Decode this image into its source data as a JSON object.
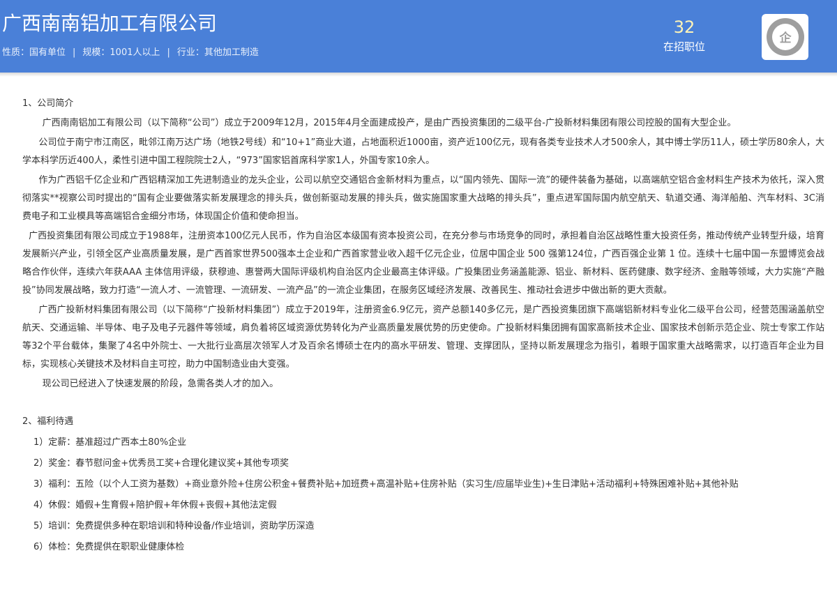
{
  "header": {
    "company_name": "广西南南铝加工有限公司",
    "nature": "性质：国有单位",
    "scale": "规模：1001人以上",
    "industry": "行业：其他加工制造",
    "separator": "|",
    "job_count": "32",
    "job_count_label": "在招职位",
    "logo_text": "企",
    "logo_icon": "company-logo-icon"
  },
  "intro": {
    "title": "1、公司简介",
    "paragraphs": [
      "广西南南铝加工有限公司（以下简称“公司”）成立于2009年12月，2015年4月全面建成投产，是由广西投资集团的二级平台-广投新材料集团有限公司控股的国有大型企业。",
      "公司位于南宁市江南区，毗邻江南万达广场（地铁2号线）和“10+1”商业大道，占地面积近1000亩，资产近100亿元，现有各类专业技术人才500余人，其中博士学历11人，硕士学历80余人，大学本科学历近400人，柔性引进中国工程院院士2人，“973”国家铝首席科学家1人，外国专家10余人。",
      "作为广西铝千亿企业和广西铝精深加工先进制造业的龙头企业，公司以航空交通铝合金新材料为重点，以“国内领先、国际一流”的硬件装备为基础，以高端航空铝合金材料生产技术为依托，深入贯彻落实**视察公司时提出的“国有企业要做落实新发展理念的排头兵，做创新驱动发展的排头兵，做实施国家重大战略的排头兵”，重点进军国际国内航空航天、轨道交通、海洋船舶、汽车材料、3C消费电子和工业模具等高端铝合金细分市场，体现国企价值和使命担当。",
      "广西投资集团有限公司成立于1988年，注册资本100亿元人民币，作为自治区本级国有资本投资公司，在充分参与市场竞争的同时，承担着自治区战略性重大投资任务，推动传统产业转型升级，培育发展新兴产业，引领全区产业高质量发展，是广西首家世界500强本土企业和广西首家营业收入超千亿元企业，位居中国企业 500 强第124位，广西百强企业第 1 位。连续十七届中国一东盟博览会战略合作伙伴，连续六年获AAA 主体信用评级，获穆迪、惠誉两大国际评级机构自治区内企业最高主体评级。广投集团业务涵盖能源、铝业、新材料、医药健康、数字经济、金融等领域，大力实施“产融投”协同发展战略，致力打造“一流人才、一流管理、一流研发、一流产品”的一流企业集团，在服务区域经济发展、改善民生、推动社会进步中做出新的更大贡献。",
      "广西广投新材料集团有限公司（以下简称“广投新材料集团”）成立于2019年，注册资金6.9亿元，资产总额140多亿元，是广西投资集团旗下高端铝新材料专业化二级平台公司，经营范围涵盖航空航天、交通运输、半导体、电子及电子元器件等领域，肩负着将区域资源优势转化为产业高质量发展优势的历史使命。广投新材料集团拥有国家高新技术企业、国家技术创新示范企业、院士专家工作站等32个平台载体，集聚了4名中外院士、一大批行业高层次领军人才及百余名博硕士在内的高水平研发、管理、支撑团队，坚持以新发展理念为指引，着眼于国家重大战略需求，以打造百年企业为目标，实现核心关键技术及材料自主可控，助力中国制造业由大变强。",
      "现公司已经进入了快速发展的阶段，急需各类人才的加入。"
    ]
  },
  "benefits": {
    "title": "2、福利待遇",
    "items": [
      "1）定薪：基准超过广西本土80%企业",
      "2）奖金：春节慰问金+优秀员工奖+合理化建议奖+其他专项奖",
      "3）福利：五险（以个人工资为基数）+商业意外险+住房公积金+餐费补贴+加班费+高温补贴+住房补贴（实习生/应届毕业生)+生日津贴+活动福利+特殊困难补贴+其他补贴",
      "4）休假：婚假+生育假+陪护假+年休假+丧假+其他法定假",
      "5）培训：免费提供多种在职培训和特种设备/作业培训，资助学历深造",
      "6）体检：免费提供在职职业健康体检"
    ]
  }
}
